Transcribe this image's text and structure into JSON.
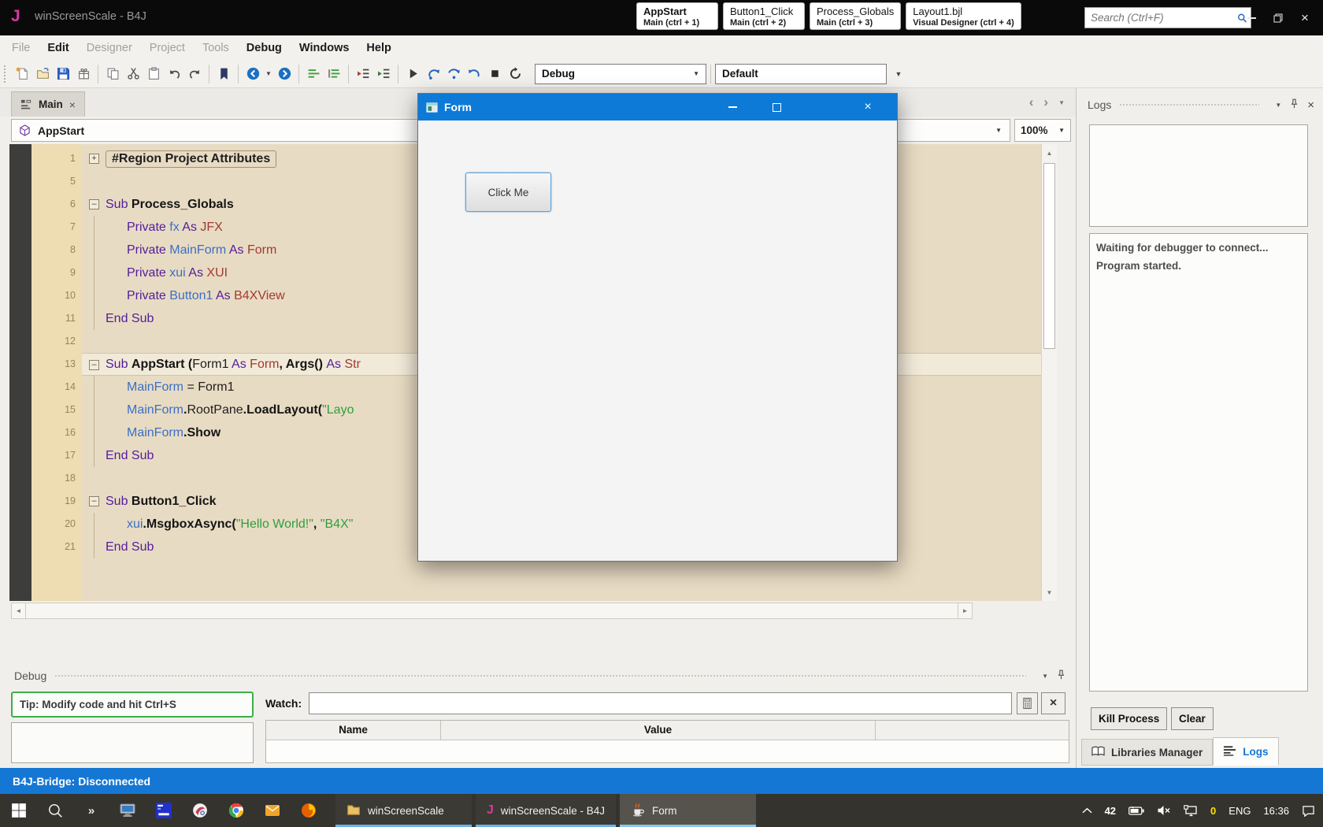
{
  "titlebar": {
    "logo": "J",
    "title": "winScreenScale - B4J",
    "search_placeholder": "Search (Ctrl+F)",
    "quick_tabs": [
      {
        "title": "AppStart",
        "subtitle": "Main  (ctrl + 1)",
        "emph": true
      },
      {
        "title": "Button1_Click",
        "subtitle": "Main  (ctrl + 2)",
        "emph": false
      },
      {
        "title": "Process_Globals",
        "subtitle": "Main  (ctrl + 3)",
        "emph": false
      },
      {
        "title": "Layout1.bjl",
        "subtitle": "Visual Designer  (ctrl + 4)",
        "emph": false
      }
    ]
  },
  "menubar": {
    "items": [
      {
        "label": "File",
        "enabled": false
      },
      {
        "label": "Edit",
        "enabled": true
      },
      {
        "label": "Designer",
        "enabled": false
      },
      {
        "label": "Project",
        "enabled": false
      },
      {
        "label": "Tools",
        "enabled": false
      },
      {
        "label": "Debug",
        "enabled": true
      },
      {
        "label": "Windows",
        "enabled": true
      },
      {
        "label": "Help",
        "enabled": true
      }
    ]
  },
  "toolbar": {
    "mode_select": "Debug",
    "config_select": "Default",
    "icon_groups": [
      [
        "new-file",
        "open-project",
        "save",
        "package"
      ],
      [
        "copy",
        "cut",
        "paste",
        "undo",
        "redo"
      ],
      [
        "bookmark"
      ],
      [
        "navigate-back",
        "nav-caret",
        "navigate-forward"
      ],
      [
        "comment",
        "uncomment"
      ],
      [
        "outdent",
        "indent"
      ],
      [
        "run",
        "step-into",
        "step-over",
        "resume",
        "stop",
        "restart"
      ]
    ]
  },
  "doc_tabs": {
    "tabs": [
      {
        "label": "Main",
        "active": true
      }
    ]
  },
  "breadcrumb": {
    "module": "AppStart",
    "zoom_level": "100%"
  },
  "editor": {
    "lines": [
      {
        "n": "1",
        "fold": "+",
        "region": true,
        "tokens": [
          [
            "#Region Project Attributes",
            "pl"
          ]
        ]
      },
      {
        "n": "5",
        "tokens": []
      },
      {
        "n": "6",
        "fold": "-",
        "tokens": [
          [
            "Sub ",
            "kw"
          ],
          [
            "Process_Globals",
            "b"
          ]
        ]
      },
      {
        "n": "7",
        "ind": 1,
        "g": 1,
        "tokens": [
          [
            "Private ",
            "kw"
          ],
          [
            "fx ",
            "id"
          ],
          [
            "As ",
            "kw"
          ],
          [
            "JFX",
            "ty"
          ]
        ]
      },
      {
        "n": "8",
        "ind": 1,
        "g": 1,
        "tokens": [
          [
            "Private ",
            "kw"
          ],
          [
            "MainForm ",
            "id"
          ],
          [
            "As ",
            "kw"
          ],
          [
            "Form",
            "ty"
          ]
        ]
      },
      {
        "n": "9",
        "ind": 1,
        "g": 1,
        "tokens": [
          [
            "Private ",
            "kw"
          ],
          [
            "xui ",
            "id"
          ],
          [
            "As ",
            "kw"
          ],
          [
            "XUI",
            "ty"
          ]
        ]
      },
      {
        "n": "10",
        "ind": 1,
        "g": 1,
        "tokens": [
          [
            "Private ",
            "kw"
          ],
          [
            "Button1 ",
            "id"
          ],
          [
            "As ",
            "kw"
          ],
          [
            "B4XView",
            "ty"
          ]
        ]
      },
      {
        "n": "11",
        "g": 1,
        "tokens": [
          [
            "End Sub",
            "kw"
          ]
        ]
      },
      {
        "n": "12",
        "tokens": []
      },
      {
        "n": "13",
        "fold": "-",
        "hl": true,
        "tokens": [
          [
            "Sub ",
            "kw"
          ],
          [
            "AppStart (",
            "b"
          ],
          [
            "Form1 ",
            "pl"
          ],
          [
            "As ",
            "kw"
          ],
          [
            "Form",
            "ty"
          ],
          [
            ", ",
            "b"
          ],
          [
            "Args() ",
            "b"
          ],
          [
            "As ",
            "kw"
          ],
          [
            "Str",
            "ty"
          ]
        ]
      },
      {
        "n": "14",
        "ind": 1,
        "g": 1,
        "tokens": [
          [
            "MainForm",
            "id"
          ],
          [
            " = Form1",
            "pl"
          ]
        ]
      },
      {
        "n": "15",
        "ind": 1,
        "g": 1,
        "tokens": [
          [
            "MainForm",
            "id"
          ],
          [
            ".",
            "b"
          ],
          [
            "RootPane",
            "pl"
          ],
          [
            ".",
            "b"
          ],
          [
            "LoadLayout(",
            "b"
          ],
          [
            "\"Layo",
            "st"
          ]
        ]
      },
      {
        "n": "16",
        "ind": 1,
        "g": 1,
        "tokens": [
          [
            "MainForm",
            "id"
          ],
          [
            ".",
            "b"
          ],
          [
            "Show",
            "b"
          ]
        ]
      },
      {
        "n": "17",
        "g": 1,
        "tokens": [
          [
            "End Sub",
            "kw"
          ]
        ]
      },
      {
        "n": "18",
        "tokens": []
      },
      {
        "n": "19",
        "fold": "-",
        "tokens": [
          [
            "Sub ",
            "kw"
          ],
          [
            "Button1_Click",
            "b"
          ]
        ]
      },
      {
        "n": "20",
        "ind": 1,
        "g": 1,
        "tokens": [
          [
            "xui",
            "id"
          ],
          [
            ".",
            "b"
          ],
          [
            "MsgboxAsync(",
            "b"
          ],
          [
            "\"Hello World!\"",
            "st"
          ],
          [
            ", ",
            "b"
          ],
          [
            "\"B4X\"",
            "st"
          ]
        ]
      },
      {
        "n": "21",
        "g": 1,
        "tokens": [
          [
            "End Sub",
            "kw"
          ]
        ]
      }
    ]
  },
  "form_window": {
    "title": "Form",
    "button_label": "Click Me"
  },
  "debug_panel": {
    "title": "Debug",
    "tip": "Tip: Modify code and hit Ctrl+S",
    "watch_label": "Watch:",
    "watch_value": "",
    "columns": [
      "Name",
      "Value"
    ]
  },
  "logs_panel": {
    "title": "Logs",
    "log_lines": [
      "Waiting for debugger to connect...",
      "Program started."
    ],
    "kill_process_label": "Kill Process",
    "clear_label": "Clear",
    "tabs": [
      {
        "label": "Libraries Manager",
        "icon": "book",
        "active": false
      },
      {
        "label": "Logs",
        "icon": "log-lines",
        "active": true
      }
    ]
  },
  "statusbar": {
    "text": "B4J-Bridge: Disconnected"
  },
  "taskbar": {
    "overflow_chevron": "»",
    "app_icons": [
      "start",
      "search",
      "overflow",
      "desktop",
      "b4j-designer",
      "media-tool",
      "chrome",
      "outlook",
      "firefox"
    ],
    "buttons": [
      {
        "label": "winScreenScale",
        "icon": "folder",
        "active": false
      },
      {
        "label": "winScreenScale - B4J",
        "icon": "b4j",
        "active": false
      },
      {
        "label": "Form",
        "icon": "java",
        "active": true
      }
    ],
    "tray_items": [
      {
        "icon": "chevron-up",
        "name": "tray-expand"
      },
      {
        "text": "42",
        "bold": true,
        "name": "tray-badge"
      },
      {
        "icon": "battery",
        "name": "battery-icon"
      },
      {
        "icon": "volume-muted",
        "name": "volume-muted-icon"
      },
      {
        "icon": "network",
        "name": "network-icon"
      },
      {
        "text": "0",
        "color": "#ffe400",
        "bold": true,
        "name": "tray-zero-badge"
      },
      {
        "text": "ENG",
        "name": "language-indicator"
      },
      {
        "text": "16:36",
        "name": "clock"
      },
      {
        "icon": "action-center",
        "name": "action-center-icon"
      }
    ]
  },
  "colors": {
    "accent_blue": "#0d7ad8",
    "status_blue": "#1577d4",
    "keyword_purple": "#531d9a",
    "type_red": "#a13a30",
    "identifier_blue": "#3b6fc4",
    "string_green": "#2f9e3f",
    "tip_green": "#3dae4a",
    "logo_magenta": "#d63a9e"
  }
}
